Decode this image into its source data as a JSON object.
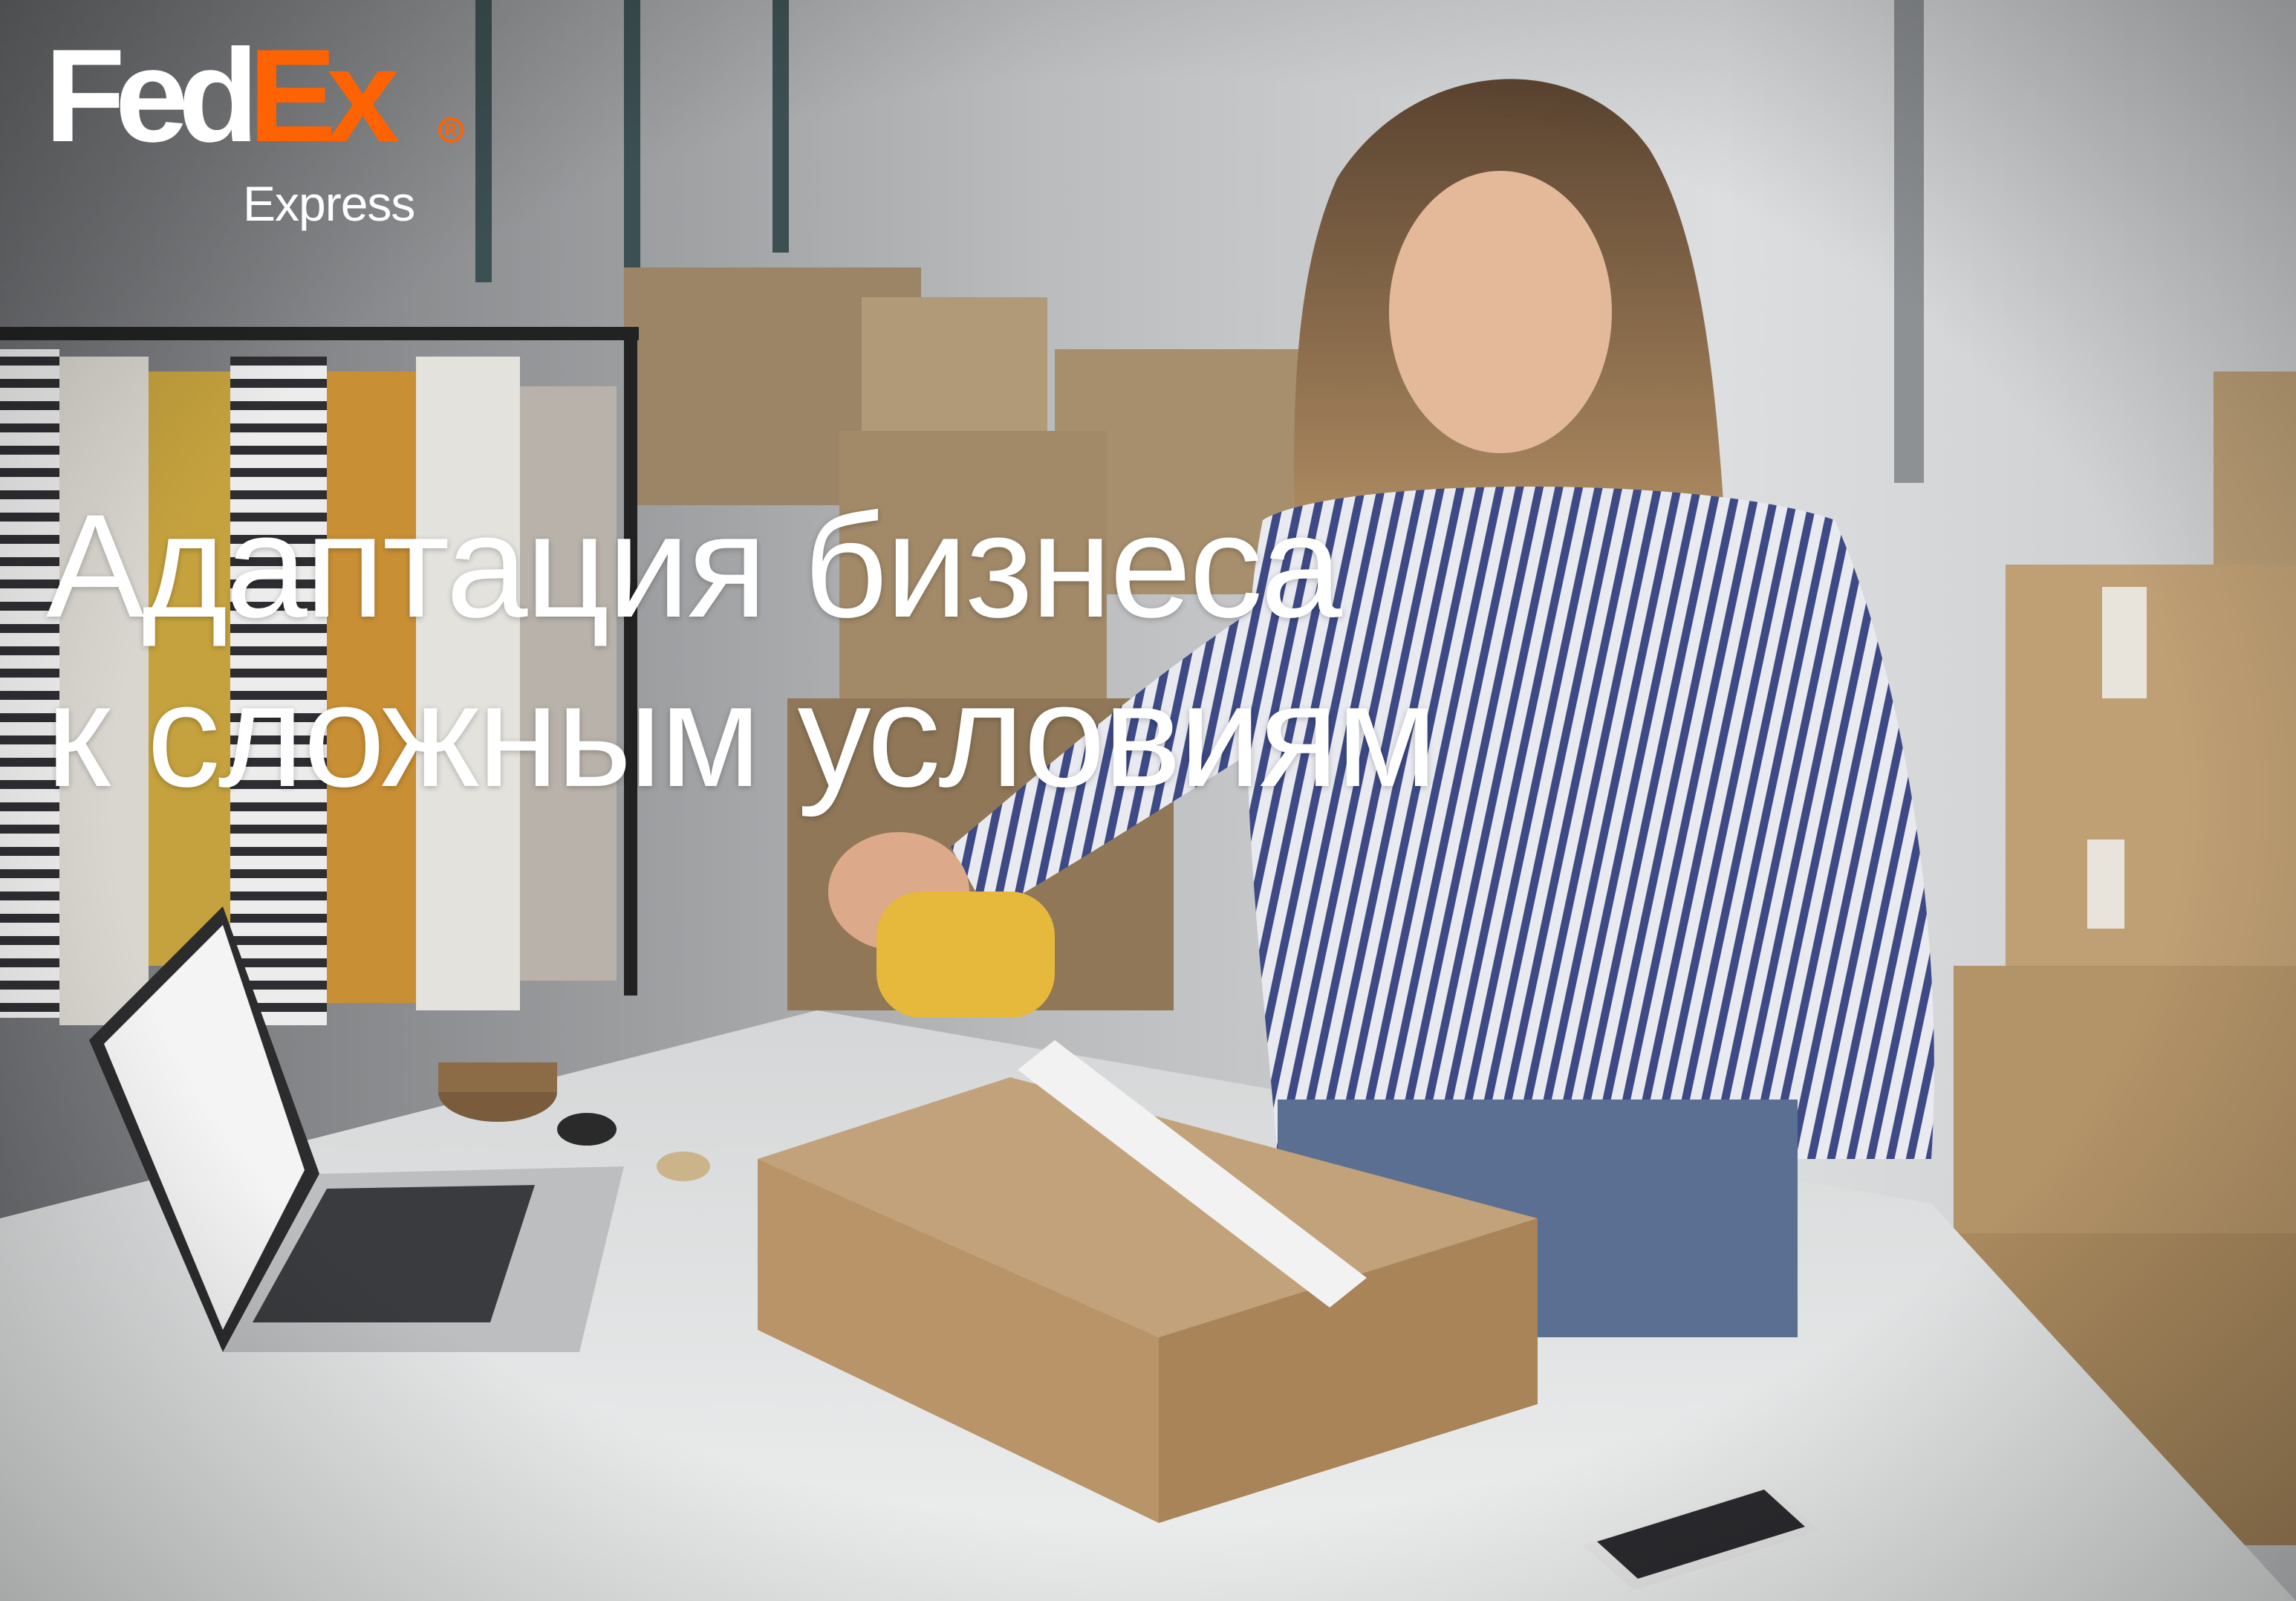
{
  "brand": {
    "name_part1": "Fed",
    "name_part2": "Ex",
    "registered_mark": "R",
    "division": "Express",
    "colors": {
      "white": "#ffffff",
      "orange": "#ff6200"
    }
  },
  "headline": {
    "line1": "Адаптация бизнеса",
    "line2": "к сложным условиям"
  }
}
